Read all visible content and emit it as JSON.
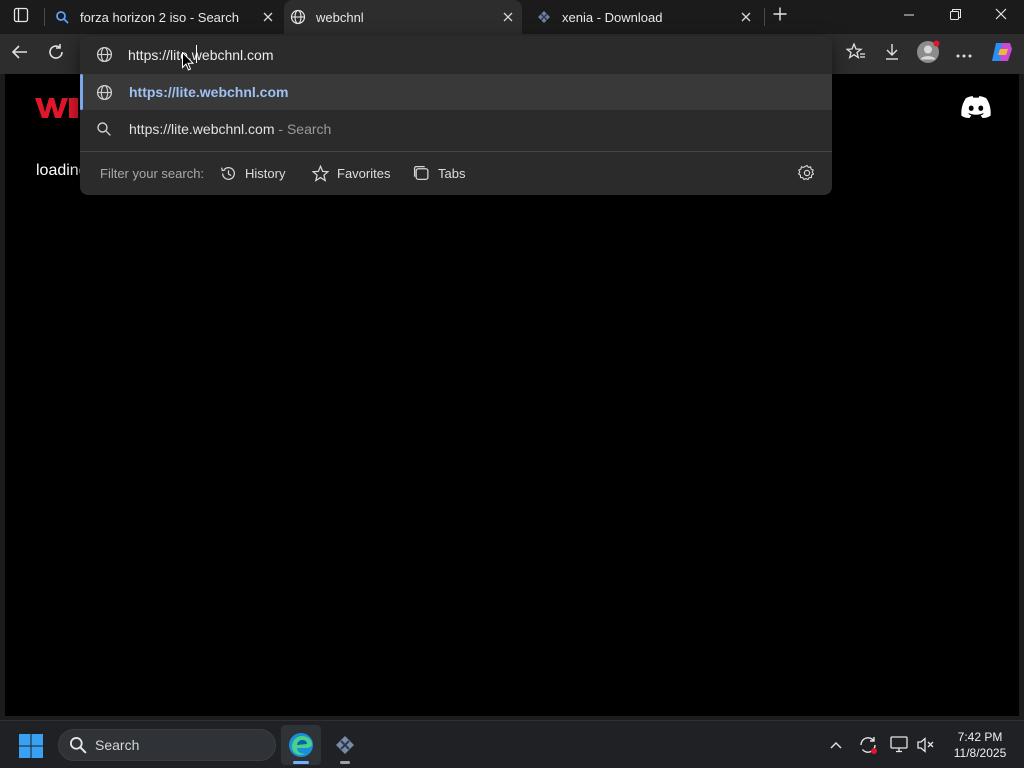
{
  "tabs": [
    {
      "title": "forza horizon 2 iso - Search",
      "icon": "search-icon",
      "active": false
    },
    {
      "title": "webchnl",
      "icon": "globe-icon",
      "active": true
    },
    {
      "title": "xenia - Download",
      "icon": "xenia-icon",
      "active": false
    }
  ],
  "address_bar": {
    "value": "https://lite.webchnl.com"
  },
  "suggestions": [
    {
      "text": "https://lite.webchnl.com",
      "icon": "globe-icon",
      "selected": true
    },
    {
      "text": "https://lite.webchnl.com",
      "suffix": " - Search",
      "icon": "search-icon",
      "selected": false
    }
  ],
  "filter": {
    "label": "Filter your search:",
    "chips": [
      {
        "label": "History",
        "icon": "history-icon"
      },
      {
        "label": "Favorites",
        "icon": "star-icon"
      },
      {
        "label": "Tabs",
        "icon": "tabs-icon"
      }
    ]
  },
  "page": {
    "loading_text": "loading",
    "logo": "webchnl-logo",
    "discord": "discord-icon",
    "brand_color": "#e0162b"
  },
  "taskbar": {
    "search_placeholder": "Search",
    "time": "7:42 PM",
    "date": "11/8/2025",
    "apps": [
      "edge-icon",
      "xenia-icon"
    ]
  }
}
